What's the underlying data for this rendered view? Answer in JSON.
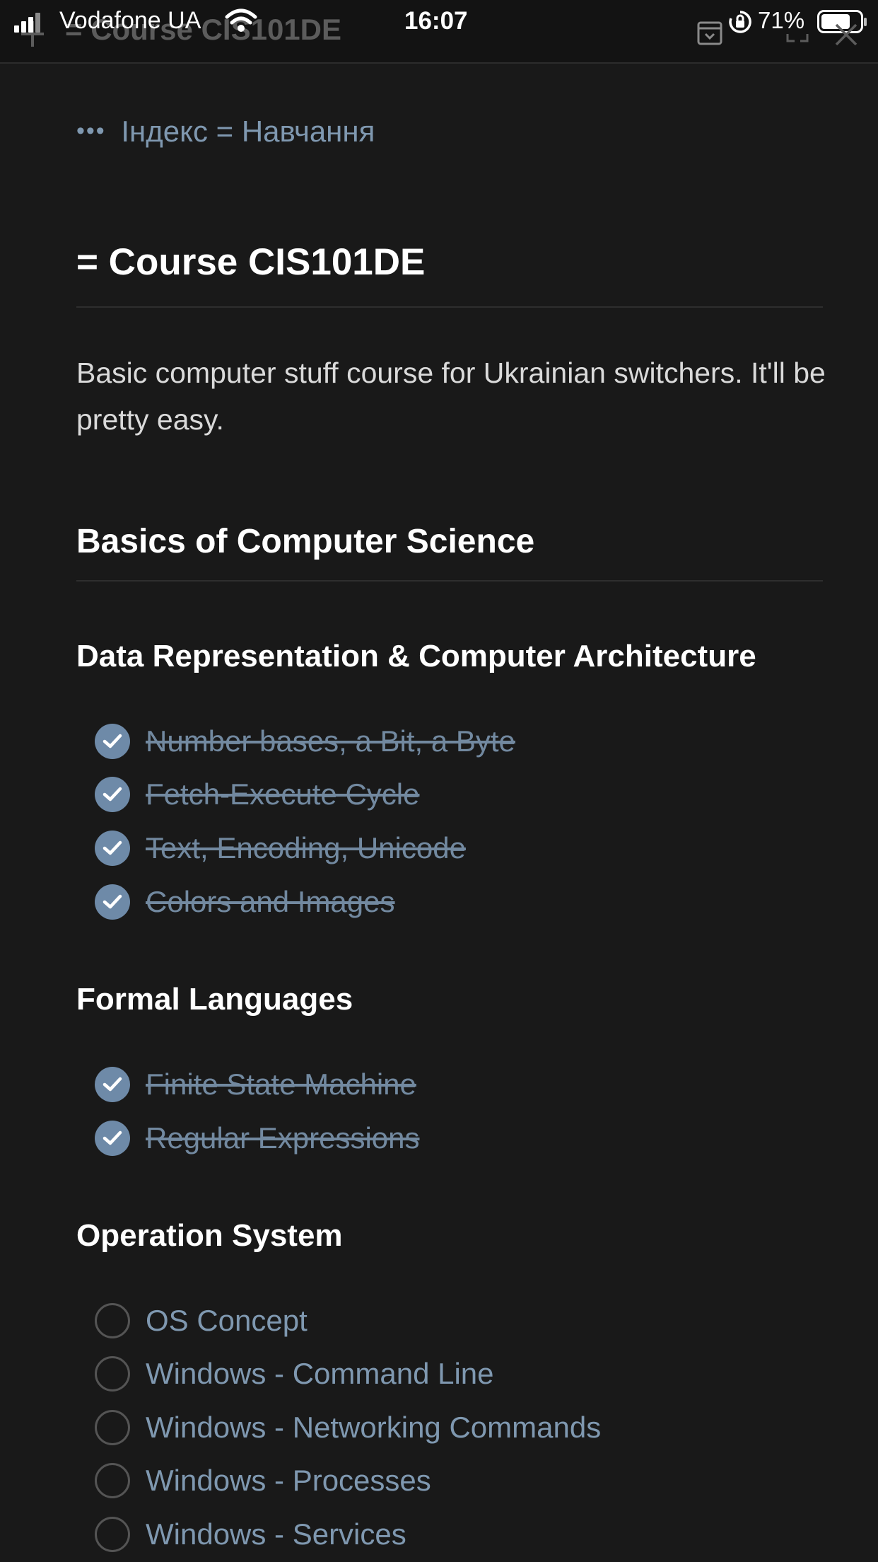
{
  "status_bar": {
    "carrier": "Vodafone UA",
    "time": "16:07",
    "battery": "71%"
  },
  "toolbar": {
    "title": "= Course CIS101DE"
  },
  "breadcrumb": {
    "dots": "•••",
    "text": "Індекс = Навчання"
  },
  "page": {
    "title": "= Course CIS101DE",
    "description": "Basic computer stuff course for Ukrainian switchers. It'll be pretty easy."
  },
  "sections": {
    "h2": "Basics of Computer Science",
    "data_rep": {
      "title": "Data Representation & Computer Architecture",
      "items": [
        {
          "label": "Number bases, a Bit, a Byte",
          "checked": true
        },
        {
          "label": "Fetch-Execute Cycle",
          "checked": true
        },
        {
          "label": "Text, Encoding, Unicode",
          "checked": true
        },
        {
          "label": "Colors and Images",
          "checked": true
        }
      ]
    },
    "formal": {
      "title": "Formal Languages",
      "items": [
        {
          "label": "Finite State Machine",
          "checked": true
        },
        {
          "label": "Regular Expressions",
          "checked": true
        }
      ]
    },
    "os": {
      "title": "Operation System",
      "items": [
        {
          "label": "OS Concept",
          "checked": false
        },
        {
          "label": "Windows - Command Line",
          "checked": false
        },
        {
          "label": "Windows - Networking Commands",
          "checked": false
        },
        {
          "label": "Windows - Processes",
          "checked": false
        },
        {
          "label": "Windows - Services",
          "checked": false
        }
      ]
    }
  },
  "colors": {
    "background": "#191919",
    "link": "#7f98b0",
    "checkbox_checked": "#6e8aa8"
  },
  "icons": [
    "signal-icon",
    "wifi-icon",
    "plus-icon",
    "archive-icon",
    "orientation-lock-icon",
    "battery-icon",
    "collapse-icon",
    "close-icon",
    "check-icon"
  ]
}
